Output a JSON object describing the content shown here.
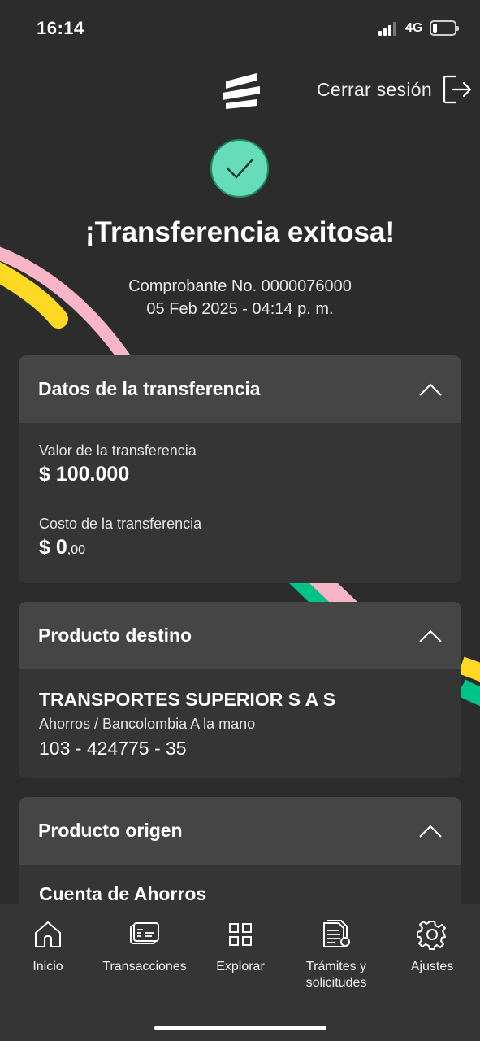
{
  "status_bar": {
    "time": "16:14",
    "network": "4G"
  },
  "header": {
    "logout_label": "Cerrar sesión"
  },
  "success": {
    "title": "¡Transferencia exitosa!",
    "receipt_line": "Comprobante No. 0000076000",
    "date_line": "05 Feb 2025 - 04:14 p. m."
  },
  "transfer_card": {
    "title": "Datos de la transferencia",
    "value_label": "Valor de la transferencia",
    "value": "$ 100.000",
    "cost_label": "Costo de la transferencia",
    "cost_integer": "$ 0",
    "cost_decimals": ",00"
  },
  "destination_card": {
    "title": "Producto destino",
    "name": "TRANSPORTES SUPERIOR S  A S",
    "type": "Ahorros / Bancolombia A la mano",
    "number": "103 - 424775 - 35"
  },
  "origin_card": {
    "title": "Producto origen",
    "account_name": "Cuenta de Ahorros"
  },
  "bottom_nav": {
    "items": [
      {
        "label": "Inicio",
        "icon": "home-icon"
      },
      {
        "label": "Transacciones",
        "icon": "transactions-icon"
      },
      {
        "label": "Explorar",
        "icon": "grid-icon"
      },
      {
        "label": "Trámites y solicitudes",
        "icon": "documents-icon"
      },
      {
        "label": "Ajustes",
        "icon": "gear-icon"
      }
    ]
  },
  "colors": {
    "background": "#2c2c2c",
    "card_body": "#353535",
    "card_header": "#454545",
    "success_green": "#66ddb8",
    "decor_yellow": "#fdd923",
    "decor_pink": "#f8b5c8",
    "decor_green": "#00c389"
  }
}
